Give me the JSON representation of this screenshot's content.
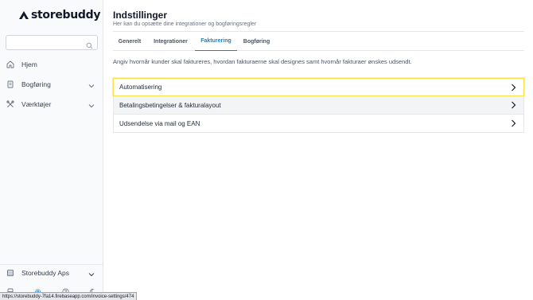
{
  "app": {
    "logo_text": "storebuddy"
  },
  "sidebar": {
    "search": {
      "value": "",
      "placeholder": ""
    },
    "items": [
      {
        "label": "Hjem",
        "icon": "home-icon",
        "expandable": false
      },
      {
        "label": "Bogføring",
        "icon": "ledger-icon",
        "expandable": true
      },
      {
        "label": "Værktøjer",
        "icon": "tools-icon",
        "expandable": true
      }
    ],
    "footer_item": {
      "label": "Storebuddy Aps",
      "icon": "company-icon",
      "expandable": true
    },
    "bottom_icons": [
      "database-icon",
      "settings-icon",
      "help-icon",
      "moon-icon"
    ]
  },
  "header": {
    "title": "Indstillinger",
    "subtitle": "Her kan du opsætte dine integrationer og bogføringsregler"
  },
  "tabs": [
    {
      "label": "Generelt",
      "active": false
    },
    {
      "label": "Integrationer",
      "active": false
    },
    {
      "label": "Fakturering",
      "active": true
    },
    {
      "label": "Bogføring",
      "active": false
    }
  ],
  "main": {
    "description": "Angiv hvornår kunder skal faktureres, hvordan fakturaerne skal designes samt hvornår fakturaer ønskes udsendt.",
    "rows": [
      {
        "label": "Automatisering",
        "state": "focused"
      },
      {
        "label": "Betalingsbetingelser & fakturalayout",
        "state": "hover"
      },
      {
        "label": "Udsendelse via mail og EAN",
        "state": "normal"
      }
    ]
  },
  "statusbar": {
    "url": "https://storebuddy-7fa14.firebaseapp.com/invoice-settings/474"
  },
  "colors": {
    "accent": "#1e7fc1",
    "focus_outline": "#fde047",
    "sidebar_bg": "#f9fafb"
  }
}
